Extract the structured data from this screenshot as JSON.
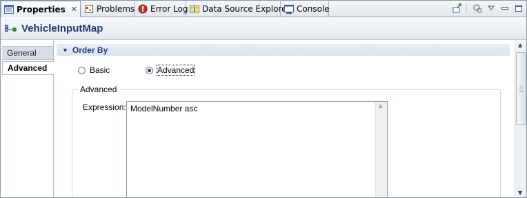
{
  "tabs": [
    {
      "label": "Properties",
      "icon": "properties-icon",
      "active": true
    },
    {
      "label": "Problems",
      "icon": "problems-icon"
    },
    {
      "label": "Error Log",
      "icon": "error-log-icon"
    },
    {
      "label": "Data Source Explorer",
      "icon": "data-source-explorer-icon"
    },
    {
      "label": "Console",
      "icon": "console-icon"
    }
  ],
  "tab_close_glyph": "✕",
  "title": "VehicleInputMap",
  "side_tabs": {
    "general": "General",
    "advanced": "Advanced"
  },
  "section": {
    "title": "Order By",
    "expanded": true
  },
  "radios": {
    "basic": "Basic",
    "advanced": "Advanced",
    "selected": "Advanced"
  },
  "group": {
    "legend": "Advanced"
  },
  "expression": {
    "label": "Expression:",
    "value": "ModelNumber asc"
  },
  "colors": {
    "title": "#1c3a6e",
    "section": "#1d3b7a"
  }
}
